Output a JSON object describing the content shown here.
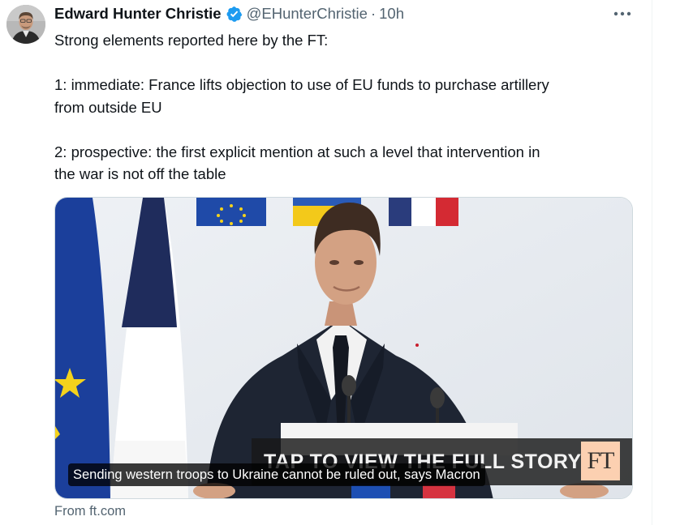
{
  "tweet": {
    "author": {
      "display_name": "Edward Hunter Christie",
      "handle": "@EHunterChristie",
      "verified": true
    },
    "separator": "·",
    "time": "10h",
    "text_lines": [
      "Strong elements reported here by the FT:",
      "1: immediate: France lifts objection to use of EU funds to purchase artillery",
      "from outside EU",
      "2: prospective: the first explicit mention at such a level that intervention in",
      "the war is not off the table"
    ],
    "card": {
      "caption": "Sending western troops to Ukraine cannot be ruled out, says Macron",
      "banner_text": "TAP TO VIEW THE FULL STORY",
      "logo_text": "FT",
      "source": "From ft.com"
    }
  },
  "colors": {
    "verified_blue": "#1d9bf0",
    "secondary_text": "#536471",
    "ft_pink": "#fcd0b1"
  },
  "icons": [
    "more-icon",
    "verified-badge-icon"
  ]
}
